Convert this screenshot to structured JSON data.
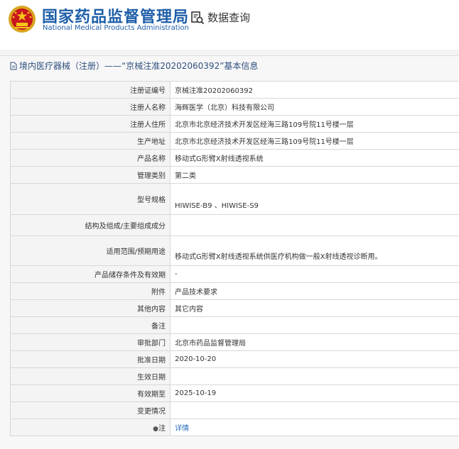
{
  "header": {
    "org_name_cn": "国家药品监督管理局",
    "org_name_en": "National Medical Products Administration",
    "query_label": "数据查询"
  },
  "breadcrumb": {
    "text": "境内医疗器械（注册）——“京械注准20202060392”基本信息"
  },
  "rows": [
    {
      "label": "注册证编号",
      "value": "京械注准20202060392"
    },
    {
      "label": "注册人名称",
      "value": "海辉医学（北京）科技有限公司"
    },
    {
      "label": "注册人住所",
      "value": "北京市北京经济技术开发区经海三路109号院11号楼一层"
    },
    {
      "label": "生产地址",
      "value": "北京市北京经济技术开发区经海三路109号院11号楼一层"
    },
    {
      "label": "产品名称",
      "value": "移动式G形臂X射线透视系统"
    },
    {
      "label": "管理类别",
      "value": "第二类"
    },
    {
      "label": "型号规格",
      "value": "HIWISE-B9 、HIWISE-S9"
    },
    {
      "label": "结构及组成/主要组成成分",
      "value": ""
    },
    {
      "label": "适用范围/预期用途",
      "value": "移动式G形臂X射线透视系统供医疗机构做一般X射线透视诊断用。"
    },
    {
      "label": "产品储存条件及有效期",
      "value": "-"
    },
    {
      "label": "附件",
      "value": "产品技术要求"
    },
    {
      "label": "其他内容",
      "value": "其它内容"
    },
    {
      "label": "备注",
      "value": ""
    },
    {
      "label": "审批部门",
      "value": "北京市药品监督管理局"
    },
    {
      "label": "批准日期",
      "value": "2020-10-20"
    },
    {
      "label": "生效日期",
      "value": ""
    },
    {
      "label": "有效期至",
      "value": "2025-10-19"
    },
    {
      "label": "变更情况",
      "value": ""
    },
    {
      "label": "注",
      "value": "详情"
    }
  ]
}
